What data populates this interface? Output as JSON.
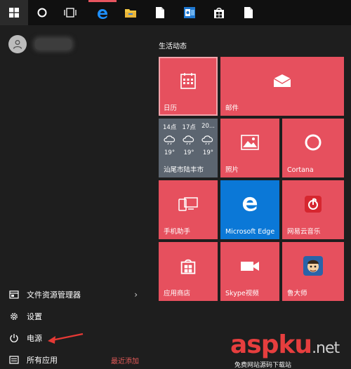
{
  "taskbar": {
    "items": [
      {
        "name": "start",
        "icon": "windows-logo-icon"
      },
      {
        "name": "cortana",
        "icon": "cortana-circle-icon"
      },
      {
        "name": "task-view",
        "icon": "task-view-icon"
      },
      {
        "name": "edge",
        "icon": "edge-icon"
      },
      {
        "name": "file-explorer",
        "icon": "folder-icon"
      },
      {
        "name": "document",
        "icon": "document-icon"
      },
      {
        "name": "outlook",
        "icon": "outlook-icon"
      },
      {
        "name": "store",
        "icon": "store-icon"
      },
      {
        "name": "document-2",
        "icon": "document-icon"
      }
    ]
  },
  "left": {
    "file_explorer": "文件资源管理器",
    "settings": "设置",
    "power": "电源",
    "all_apps": "所有应用",
    "recently_added": "最近添加"
  },
  "tiles": {
    "group_title": "生活动态",
    "calendar": "日历",
    "mail": "邮件",
    "weather": {
      "hours": [
        "14点",
        "17点",
        "20..."
      ],
      "temps": [
        "19°",
        "19°",
        "19°"
      ],
      "city": "汕尾市陆丰市"
    },
    "photos": "照片",
    "cortana": "Cortana",
    "phone_companion": "手机助手",
    "edge": "Microsoft Edge",
    "netease": "网易云音乐",
    "store": "应用商店",
    "skype": "Skype视频",
    "ludashi": "鲁大师"
  },
  "colors": {
    "tile_red": "#e6505e",
    "tile_blue": "#0b78d7",
    "weather_gray": "#5c6570",
    "accent_red": "#e35a58"
  },
  "watermark": {
    "main": "aspku",
    "dot": ".net",
    "sub": "免费网站源码下载站"
  }
}
